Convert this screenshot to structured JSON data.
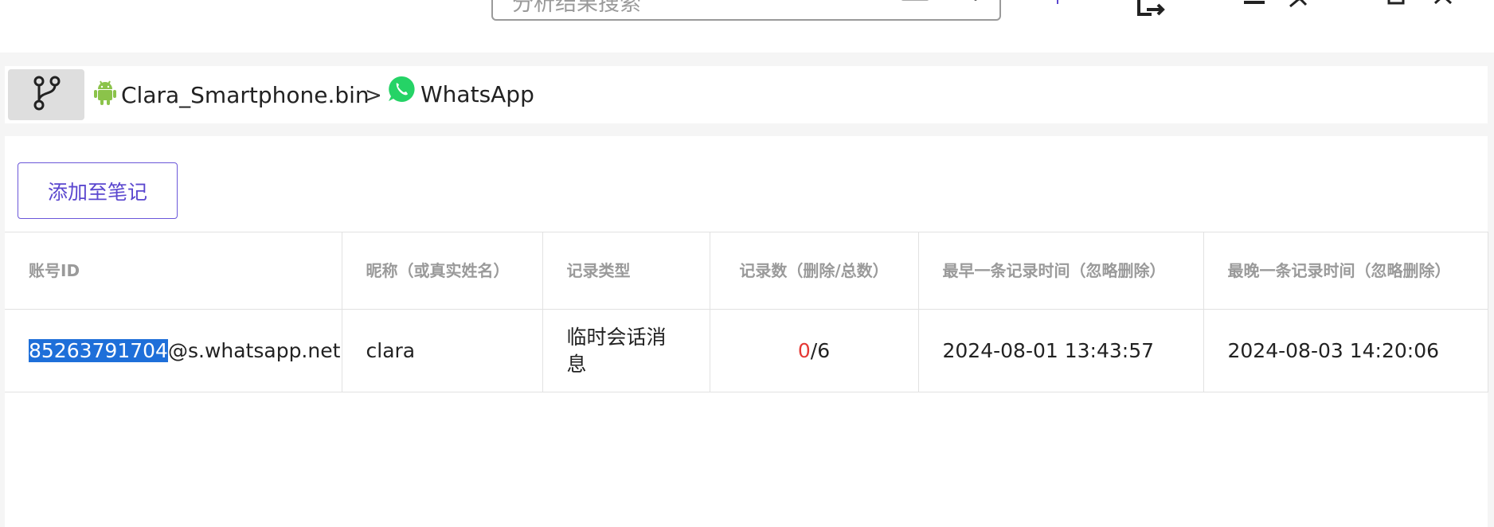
{
  "topbar": {
    "search_placeholder": "分析结果搜索",
    "icons": [
      "keyboard-icon",
      "search-icon",
      "export-icon",
      "minimize-icon",
      "pin-icon",
      "maximize-icon",
      "close-icon"
    ]
  },
  "breadcrumb": {
    "source": {
      "label": "Clara_Smartphone.bin",
      "icon": "android-icon"
    },
    "separator": ">",
    "app": {
      "label": "WhatsApp",
      "icon": "whatsapp-icon"
    }
  },
  "toolbar": {
    "add_note_label": "添加至笔记"
  },
  "table": {
    "headers": [
      "账号ID",
      "昵称（或真实姓名）",
      "记录类型",
      "记录数（删除/总数）",
      "最早一条记录时间（忽略删除）",
      "最晚一条记录时间（忽略删除）"
    ],
    "rows": [
      {
        "account_id_highlighted": "85263791704",
        "account_id_suffix": "@s.whatsapp.net",
        "nickname": "clara",
        "record_type": "临时会话消息",
        "deleted_count": "0",
        "total_count": "/6",
        "earliest_time": "2024-08-01 13:43:57",
        "latest_time": "2024-08-03 14:20:06"
      }
    ]
  },
  "colors": {
    "accent": "#5b47cf",
    "selection": "#1e6fd9",
    "deleted_red": "#e53935",
    "android_green": "#8bc34a",
    "whatsapp_green": "#25d366"
  }
}
